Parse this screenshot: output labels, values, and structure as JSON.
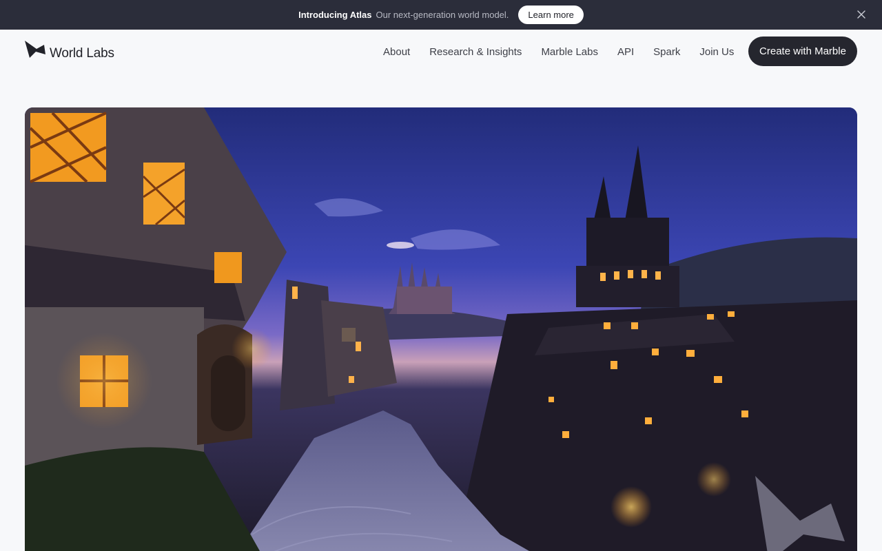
{
  "announcement": {
    "title": "Introducing Atlas",
    "description": "Our next-generation world model.",
    "button_label": "Learn more",
    "close_icon": "close-icon"
  },
  "header": {
    "logo_icon": "world-labs-logo-icon",
    "brand": "World Labs",
    "nav": [
      {
        "label": "About"
      },
      {
        "label": "Research & Insights"
      },
      {
        "label": "Marble Labs"
      },
      {
        "label": "API"
      },
      {
        "label": "Spark"
      },
      {
        "label": "Join Us"
      }
    ],
    "cta_label": "Create with Marble"
  },
  "hero": {
    "image": "medieval-village-at-dusk-image",
    "watermark_icon": "world-labs-watermark-icon"
  },
  "colors": {
    "announcement_bg": "#2b2d3a",
    "page_bg": "#f7f8fa",
    "cta_bg": "#25262e",
    "window_glow": "#f3a02a"
  }
}
